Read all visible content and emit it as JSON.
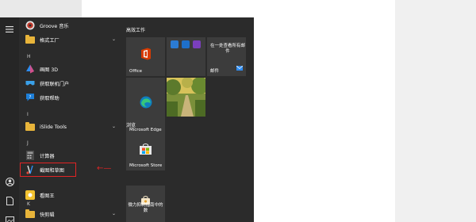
{
  "start_menu": {
    "apps": [
      {
        "label": "Groove 音乐",
        "icon": "groove-music-icon"
      },
      {
        "label": "格式工厂",
        "icon": "folder-icon",
        "expandable": true
      },
      {
        "label": "画图 3D",
        "icon": "paint-3d-icon"
      },
      {
        "label": "获取联机门户",
        "icon": "mixed-reality-portal-icon"
      },
      {
        "label": "获取帮助",
        "icon": "get-help-icon"
      },
      {
        "label": "iSlide Tools",
        "icon": "folder-icon",
        "expandable": true
      },
      {
        "label": "计算器",
        "icon": "calculator-icon"
      },
      {
        "label": "截图和草图",
        "icon": "snip-sketch-icon"
      },
      {
        "label": "看图王",
        "icon": "image-viewer-icon"
      },
      {
        "label": "快剪辑",
        "icon": "folder-icon",
        "expandable": true
      }
    ],
    "letters": [
      "H",
      "I",
      "J",
      "K"
    ],
    "tile_groups": [
      {
        "title": "高效工作"
      },
      {
        "title": "浏览"
      }
    ],
    "tiles": {
      "office": "Office",
      "mail_desc": "在一处查看所有邮件",
      "mail": "邮件",
      "edge": "Microsoft Edge",
      "store": "Microsoft Store",
      "bottom_tile_desc": "微力抑制指南中的数"
    }
  },
  "colors": {
    "menu_bg": "#2b2b2b",
    "tile_bg": "#3c3c3c",
    "highlight": "#e12424",
    "folder": "#e8b43a"
  }
}
